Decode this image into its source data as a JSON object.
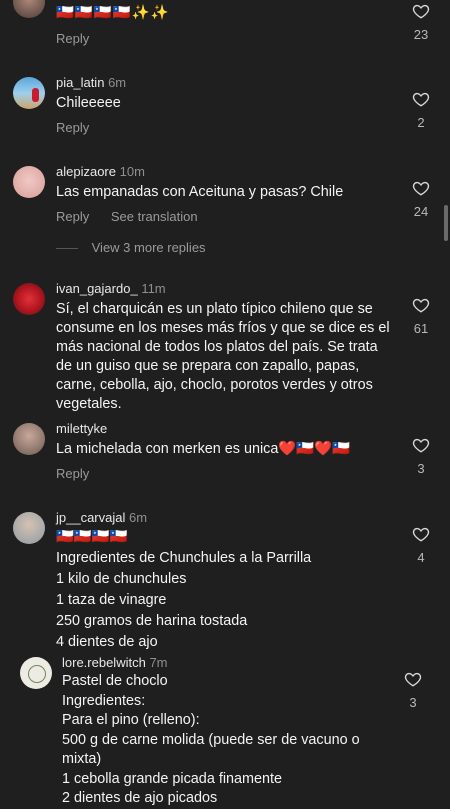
{
  "comments": [
    {
      "username": "",
      "time": "",
      "body": "🇨🇱🇨🇱🇨🇱🇨🇱✨✨",
      "reply_label": "Reply",
      "likes": "23"
    },
    {
      "username": "pia_latin",
      "time": "6m",
      "body": "Chileeeee",
      "reply_label": "Reply",
      "likes": "2"
    },
    {
      "username": "alepizaore",
      "time": "10m",
      "body": "Las empanadas con Aceituna y pasas? Chile",
      "reply_label": "Reply",
      "translate_label": "See translation",
      "likes": "24",
      "view_more": "View 3 more replies"
    },
    {
      "username": "ivan_gajardo_",
      "time": "11m",
      "body": "Sí, el charquicán es un plato típico chileno que se consume en los meses más fríos y que se dice es el más nacional de todos los platos del país. Se trata de un guiso que se prepara con zapallo, papas, carne, cebolla, ajo, choclo, porotos verdes y otros vegetales.",
      "likes": "61"
    },
    {
      "username": "milettyke",
      "time": "",
      "body": "La michelada con merken es unica❤️🇨🇱❤️🇨🇱",
      "reply_label": "Reply",
      "likes": "3"
    },
    {
      "username": "jp__carvajal",
      "time": "6m",
      "body": "🇨🇱🇨🇱🇨🇱🇨🇱\nIngredientes de Chunchules  a la Parrilla\n1 kilo de chunchules\n1 taza de vinagre\n250 gramos de  harina tostada\n4 dientes de ajo",
      "likes": "4"
    },
    {
      "username": "lore.rebelwitch",
      "time": "7m",
      "body": "Pastel de choclo\nIngredientes:\nPara el pino (relleno):\n500 g de carne molida (puede ser de vacuno o mixta)\n1 cebolla grande picada finamente\n2 dientes de ajo picados",
      "likes": "3"
    }
  ],
  "colors": {
    "background": "#1f1f1f",
    "text": "#f2f2f2",
    "muted": "#9a9a9a"
  }
}
